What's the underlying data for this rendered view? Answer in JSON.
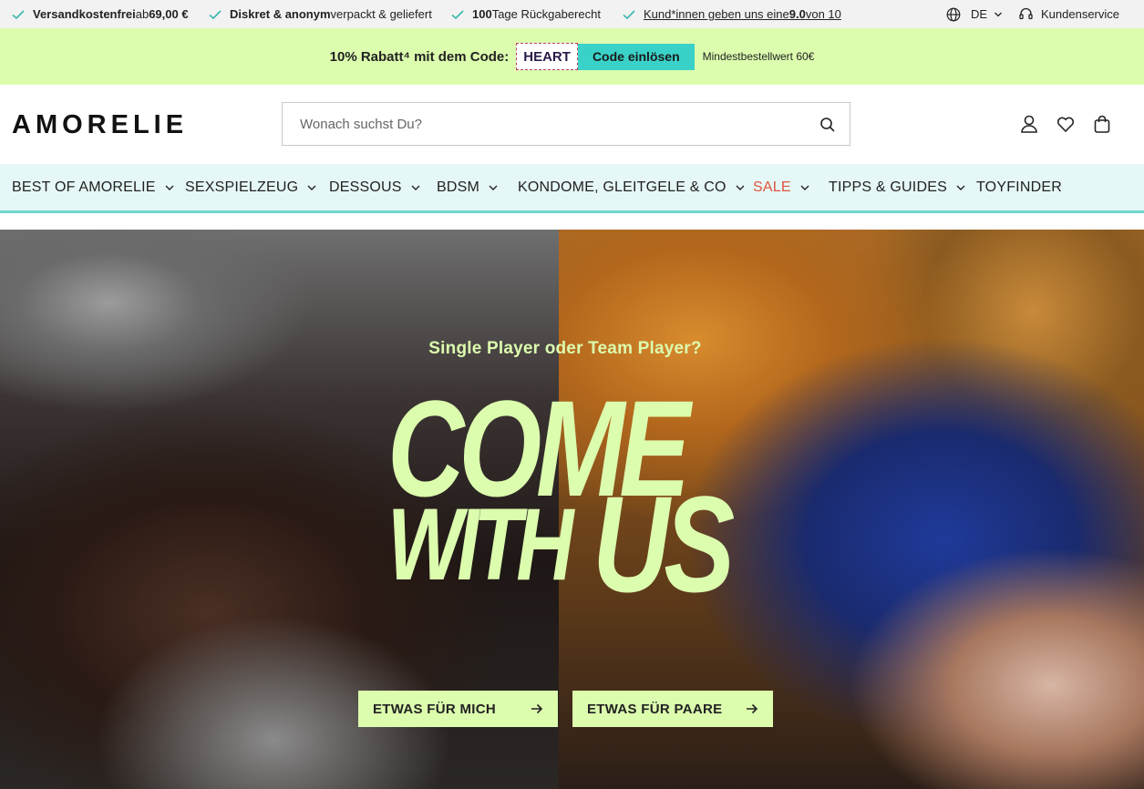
{
  "usp": {
    "items": [
      {
        "bold": "Versandkostenfrei",
        "text": " ab ",
        "bold2": "69,00 €"
      },
      {
        "bold": "Diskret & anonym",
        "text": " verpackt & geliefert"
      },
      {
        "bold": "100",
        "text": " Tage Rückgaberecht"
      },
      {
        "link": "Kund*innen geben uns eine ",
        "bold": "9.0",
        "link2": " von 10"
      }
    ],
    "language": "DE",
    "service": "Kundenservice"
  },
  "promo": {
    "text": "10% Rabatt⁴ mit dem Code:",
    "code": "HEART",
    "button": "Code einlösen",
    "min_order": "Mindestbestellwert 60€",
    "color_bg": "#dcfcae",
    "color_button": "#3ad2c8"
  },
  "header": {
    "logo": "AMORELIE",
    "search_placeholder": "Wonach suchst Du?",
    "icons": [
      "user-icon",
      "heart-icon",
      "bag-icon"
    ]
  },
  "nav": {
    "items": [
      {
        "label": "BEST OF AMORELIE",
        "has_dropdown": true
      },
      {
        "label": "SEXSPIELZEUG",
        "has_dropdown": true
      },
      {
        "label": "DESSOUS",
        "has_dropdown": true
      },
      {
        "label": "BDSM",
        "has_dropdown": true
      },
      {
        "label": "KONDOME, GLEITGELE & CO",
        "has_dropdown": true
      },
      {
        "label": "SALE",
        "has_dropdown": true,
        "color": "#e0543f"
      },
      {
        "label": "TIPPS & GUIDES",
        "has_dropdown": true
      },
      {
        "label": "TOYFINDER",
        "has_dropdown": false
      }
    ]
  },
  "hero": {
    "subtitle": "Single Player oder Team Player?",
    "title_line1": "COME",
    "title_line2a": "WITH",
    "title_line2b": "US",
    "button_left": "ETWAS FÜR MICH",
    "button_right": "ETWAS FÜR PAARE",
    "accent": "#dcfcae"
  }
}
